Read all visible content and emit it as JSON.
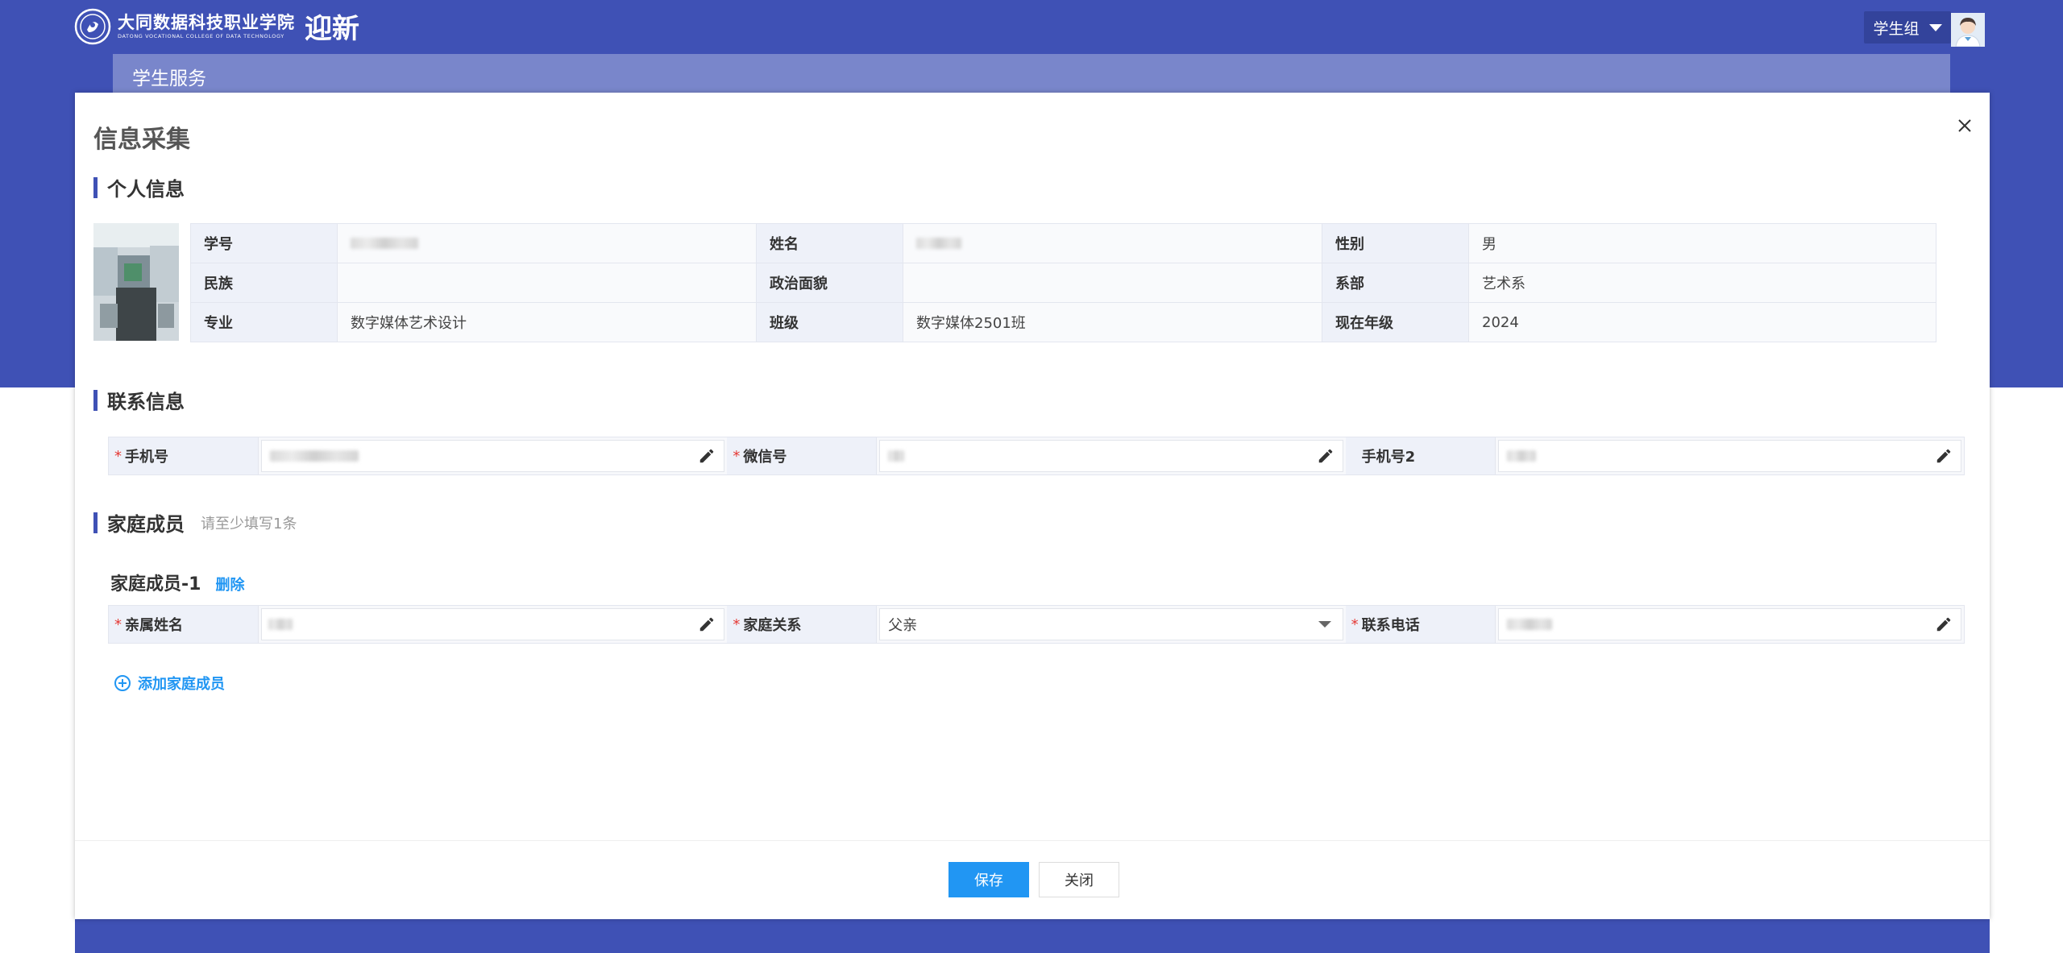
{
  "header": {
    "school_name_cn": "大同数据科技职业学院",
    "school_name_en": "DATONG VOCATIONAL COLLEGE OF DATA TECHNOLOGY",
    "app_title": "迎新",
    "user_group": "学生组",
    "theme_color": "#3f51b5"
  },
  "breadcrumb": {
    "label": "学生服务"
  },
  "modal": {
    "title": "信息采集",
    "close_icon": "close-icon"
  },
  "personal": {
    "section_title": "个人信息",
    "fields": {
      "student_id": {
        "label": "学号",
        "value": ""
      },
      "name": {
        "label": "姓名",
        "value": ""
      },
      "gender": {
        "label": "性别",
        "value": "男"
      },
      "ethnicity": {
        "label": "民族",
        "value": ""
      },
      "political_status": {
        "label": "政治面貌",
        "value": ""
      },
      "department": {
        "label": "系部",
        "value": "艺术系"
      },
      "major": {
        "label": "专业",
        "value": "数字媒体艺术设计"
      },
      "class": {
        "label": "班级",
        "value": "数字媒体2501班"
      },
      "grade": {
        "label": "现在年级",
        "value": "2024"
      }
    }
  },
  "contact": {
    "section_title": "联系信息",
    "required_mark": "*",
    "phone": {
      "label": "手机号",
      "value": ""
    },
    "wechat": {
      "label": "微信号",
      "value": ""
    },
    "phone2": {
      "label": "手机号2",
      "value": ""
    }
  },
  "family": {
    "section_title": "家庭成员",
    "hint": "请至少填写1条",
    "member_title": "家庭成员-1",
    "delete_label": "删除",
    "relative_name": {
      "label": "亲属姓名",
      "value": ""
    },
    "relation": {
      "label": "家庭关系",
      "value": "父亲"
    },
    "relative_phone": {
      "label": "联系电话",
      "value": ""
    },
    "add_label": "添加家庭成员"
  },
  "footer": {
    "save_label": "保存",
    "close_label": "关闭",
    "primary_color": "#2196f3"
  }
}
